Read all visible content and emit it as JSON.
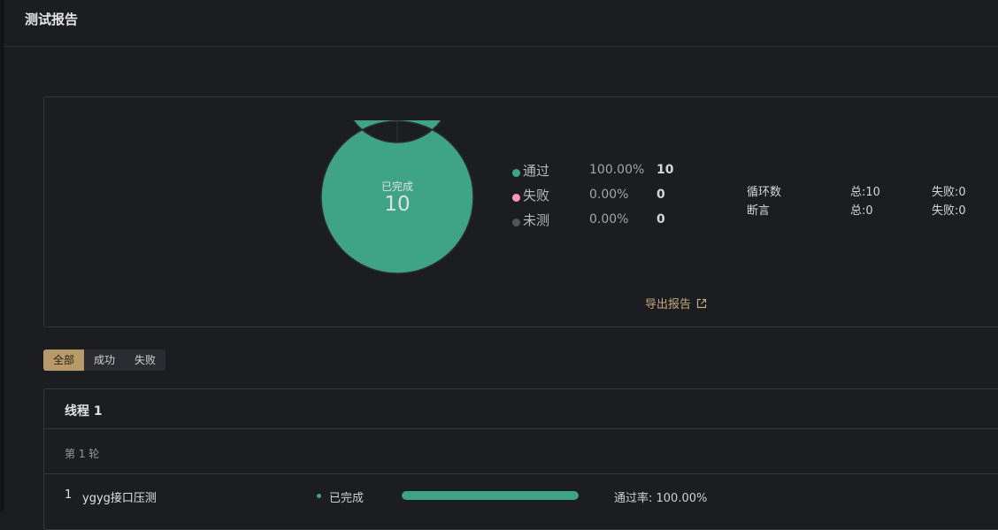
{
  "header": {
    "title": "测试报告"
  },
  "summary": {
    "donut": {
      "label": "已完成",
      "value": "10"
    },
    "chart_data": {
      "type": "pie",
      "categories": [
        "通过",
        "失败",
        "未测"
      ],
      "values": [
        10,
        0,
        0
      ]
    },
    "legend": [
      {
        "name": "通过",
        "pct": "100.00%",
        "count": "10",
        "color": "#3fa386"
      },
      {
        "name": "失败",
        "pct": "0.00%",
        "count": "0",
        "color": "#f29ab2"
      },
      {
        "name": "未测",
        "pct": "0.00%",
        "count": "0",
        "color": "#555555"
      }
    ],
    "stats": [
      {
        "label": "循环数",
        "total": "总:10",
        "fail": "失败:0"
      },
      {
        "label": "断言",
        "total": "总:0",
        "fail": "失败:0"
      }
    ],
    "export_label": "导出报告"
  },
  "filter": {
    "all": "全部",
    "success": "成功",
    "fail": "失败"
  },
  "thread": {
    "name": "线程 1",
    "round": "第 1 轮",
    "item": {
      "index": "1",
      "name": "ygyg接口压测",
      "status": "已完成",
      "progress": 1.0,
      "rate": "通过率: 100.00%"
    }
  },
  "colors": {
    "pass": "#3fa386",
    "fail": "#f29ab2",
    "untested": "#555555",
    "accent": "#b89a6a"
  }
}
